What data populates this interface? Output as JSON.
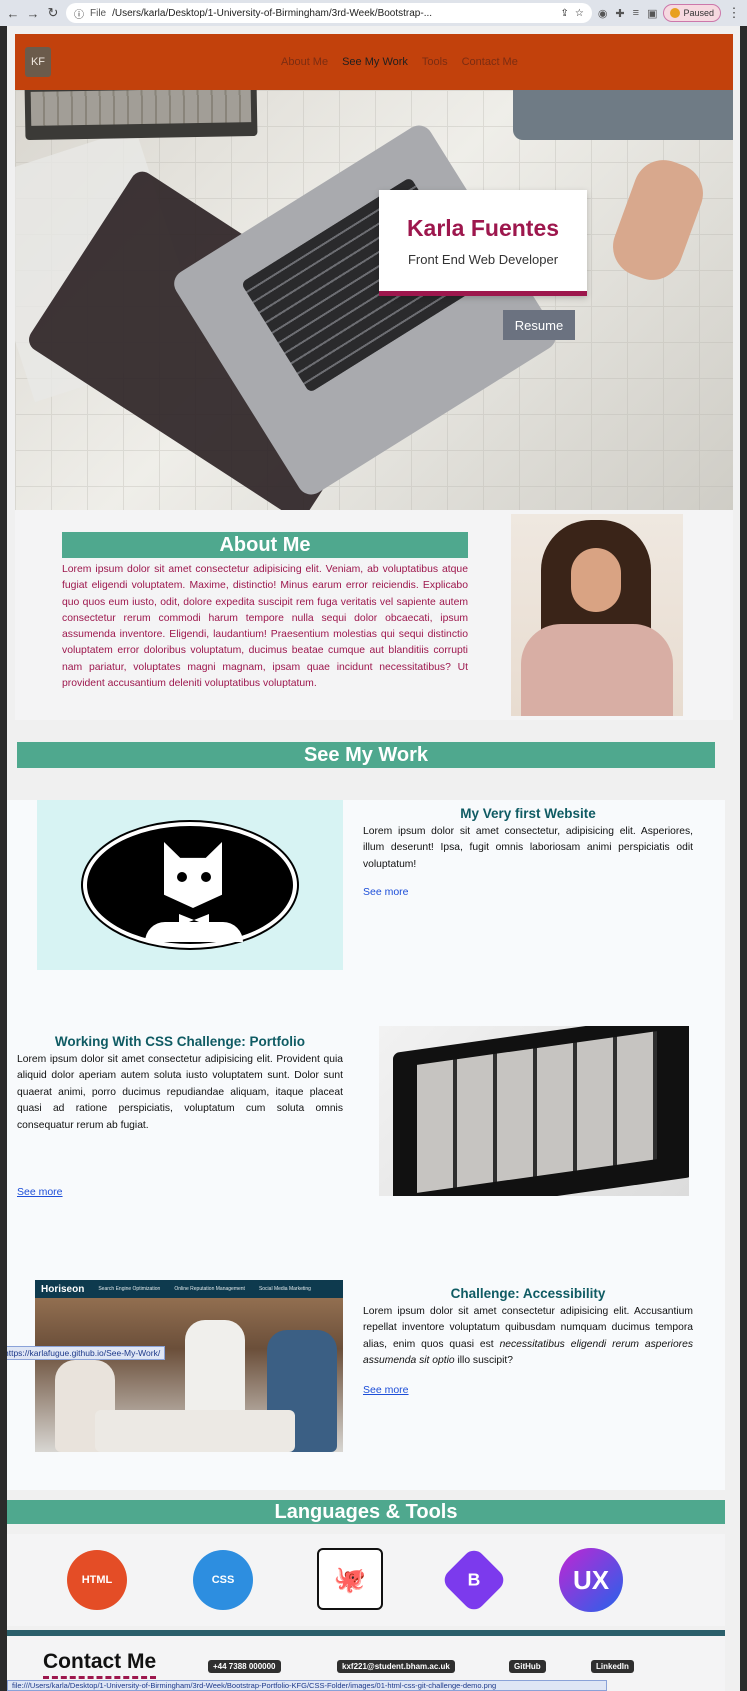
{
  "browser": {
    "url_prefix": "File",
    "url": "/Users/karla/Desktop/1-University-of-Birmingham/3rd-Week/Bootstrap-...",
    "profile_label": "Paused",
    "hover_url": "https://karlafugue.github.io/See-My-Work/",
    "status_url": "file:///Users/karla/Desktop/1-University-of-Birmingham/3rd-Week/Bootstrap-Portfolio-KFG/CSS-Folder/images/01-html-css-git-challenge-demo.png"
  },
  "nav": {
    "logo_initials": "KF",
    "links": [
      "About Me",
      "See My Work",
      "Tools",
      "Contact Me"
    ],
    "active_index": 1
  },
  "hero": {
    "name": "Karla Fuentes",
    "role": "Front End Web Developer",
    "resume_label": "Resume"
  },
  "about": {
    "heading": "About Me",
    "text": "Lorem ipsum dolor sit amet consectetur adipisicing elit. Veniam, ab voluptatibus atque fugiat eligendi voluptatem. Maxime, distinctio! Minus earum error reiciendis. Explicabo quo quos eum iusto, odit, dolore expedita suscipit rem fuga veritatis vel sapiente autem consectetur rerum commodi harum tempore nulla sequi dolor obcaecati, ipsum assumenda inventore. Eligendi, laudantium! Praesentium molestias qui sequi distinctio voluptatem error doloribus voluptatum, ducimus beatae cumque aut blanditiis corrupti nam pariatur, voluptates magni magnam, ipsam quae incidunt necessitatibus? Ut provident accusantium deleniti voluptatibus voluptatum."
  },
  "work": {
    "heading": "See My Work",
    "projects": [
      {
        "title": "My Very first Website",
        "text": "Lorem ipsum dolor sit amet consectetur, adipisicing elit. Asperiores, illum deserunt! Ipsa, fugit omnis laboriosam animi perspiciatis odit voluptatum!",
        "link": "See more"
      },
      {
        "title": "Working With CSS Challenge: Portfolio",
        "text": "Lorem ipsum dolor sit amet consectetur adipisicing elit. Provident quia aliquid dolor aperiam autem soluta iusto voluptatem sunt. Dolor sunt quaerat animi, porro ducimus repudiandae aliquam, itaque placeat quasi ad ratione perspiciatis, voluptatum cum soluta omnis consequatur rerum ab fugiat.",
        "link": "See more"
      },
      {
        "title": "Challenge: Accessibility",
        "text_plain": "Lorem ipsum dolor sit amet consectetur adipisicing elit. Accusantium repellat inventore voluptatum quibusdam numquam ducimus tempora alias, enim quos quasi est",
        "text_italic": "necessitatibus eligendi rerum asperiores assumenda sit optio",
        "text_end": "illo suscipit?",
        "link": "See more",
        "image_brand": "Horiseon",
        "image_links": [
          "Search Engine Optimization",
          "Online Reputation Management",
          "Social Media Marketing"
        ]
      }
    ]
  },
  "tools": {
    "heading": "Languages & Tools",
    "items": [
      {
        "label": "HTML",
        "icon": "html5-icon"
      },
      {
        "label": "CSS",
        "icon": "css3-icon"
      },
      {
        "label": "",
        "icon": "github-icon"
      },
      {
        "label": "B",
        "icon": "bootstrap-icon"
      },
      {
        "label": "UX",
        "icon": "ux-icon"
      }
    ]
  },
  "contact": {
    "heading": "Contact Me",
    "phone": "+44 7388 000000",
    "email": "kxf221@student.bham.ac.uk",
    "github": "GitHub",
    "linkedin": "LinkedIn"
  }
}
